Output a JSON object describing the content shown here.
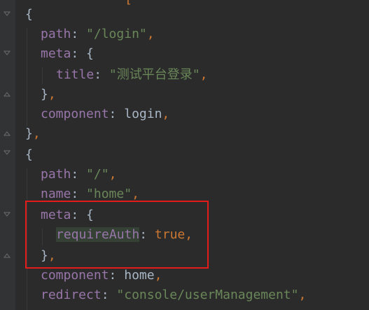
{
  "editor": {
    "top_fragment": "[",
    "obj_open": "{",
    "obj_close": "}",
    "comma": ",",
    "colon": ": ",
    "lines": {
      "path_key": "path",
      "path_login": "\"/login\"",
      "meta_key": "meta",
      "title_key": "title",
      "title_value": "\"测试平台登录\"",
      "component_key": "component",
      "component_login": "login",
      "path_root": "\"/\"",
      "name_key": "name",
      "name_value": "\"home\"",
      "require_auth_key": "requireAuth",
      "require_auth_value": "true",
      "component_home": "home",
      "redirect_key": "redirect",
      "redirect_value": "\"console/userManagement\""
    }
  },
  "colors": {
    "background": "#2b2b2b",
    "gutter": "#313335",
    "property_key": "#9876aa",
    "string": "#6a8759",
    "punctuation": "#cc7832",
    "text": "#a9b7c6",
    "highlight_box": "#e41b1b"
  },
  "icons": [
    "fold-marker-icon"
  ]
}
